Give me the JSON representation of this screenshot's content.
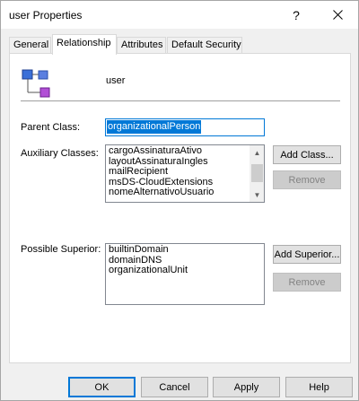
{
  "window": {
    "title": "user Properties",
    "help_glyph": "?"
  },
  "tabs": [
    {
      "label": "General"
    },
    {
      "label": "Relationship"
    },
    {
      "label": "Attributes"
    },
    {
      "label": "Default Security"
    }
  ],
  "active_tab": "Relationship",
  "class": {
    "name": "user",
    "icon": "class-hierarchy-icon"
  },
  "parent_class": {
    "label": "Parent Class:",
    "value": "organizationalPerson"
  },
  "auxiliary_classes": {
    "label": "Auxiliary Classes:",
    "items": [
      "cargoAssinaturaAtivo",
      "layoutAssinaturaIngles",
      "mailRecipient",
      "msDS-CloudExtensions",
      "nomeAlternativoUsuario"
    ],
    "add_button": "Add Class...",
    "remove_button": "Remove"
  },
  "possible_superior": {
    "label": "Possible Superior:",
    "items": [
      "builtinDomain",
      "domainDNS",
      "organizationalUnit"
    ],
    "add_button": "Add Superior...",
    "remove_button": "Remove"
  },
  "footer": {
    "ok": "OK",
    "cancel": "Cancel",
    "apply": "Apply",
    "help": "Help"
  },
  "colors": {
    "selection": "#0078d7",
    "icon_blue": "#3a6fd8",
    "icon_purple": "#b14fd6"
  }
}
